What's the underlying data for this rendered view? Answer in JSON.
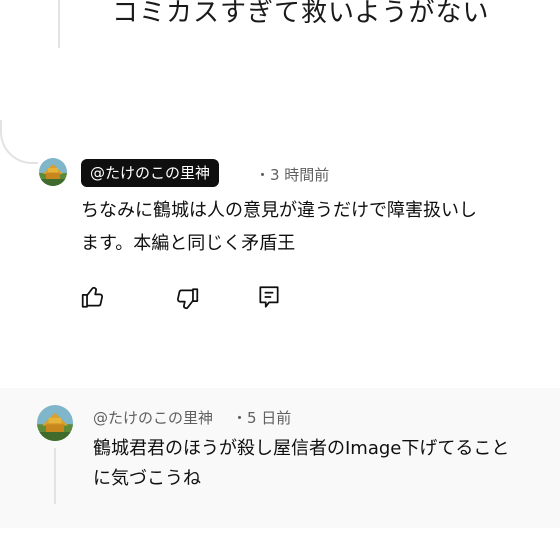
{
  "top_partial_text": "コミカスすぎて救いようがない",
  "comment1": {
    "handle": "@たけのこの里神",
    "time": "・3 時間前",
    "line1": "ちなみに鶴城は人の意見が違うだけで障害扱いし",
    "line2": "ます。本編と同じく矛盾王",
    "actions": {
      "like_icon": "thumbs-up-icon",
      "dislike_icon": "thumbs-down-icon",
      "reply_icon": "reply-comment-icon"
    }
  },
  "comment2": {
    "handle": "@たけのこの里神",
    "time": "・5 日前",
    "line1": "鶴城君君のほうが殺し屋信者のImage下げてること",
    "line2": "に気づこうね"
  },
  "colors": {
    "handle_pill_bg": "#0f0f0f",
    "meta_text": "#606060",
    "thread_line": "#e3e3e3",
    "bottom_band": "#f9f9f9"
  }
}
